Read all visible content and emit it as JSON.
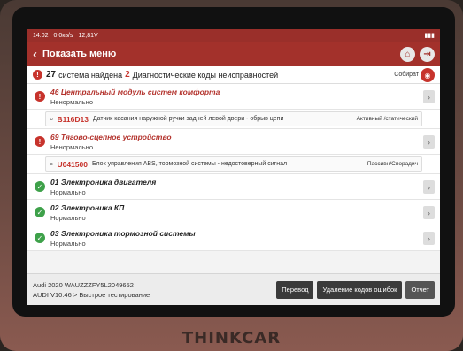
{
  "status_bar": {
    "time": "14:02",
    "speed": "0,0кв/s",
    "voltage": "12,81V"
  },
  "header": {
    "back_icon": "chevron-left-icon",
    "title": "Показать меню",
    "home_icon": "home-icon",
    "exit_icon": "exit-icon"
  },
  "summary": {
    "systems_count": "27",
    "systems_text": "система найдена",
    "dtc_count": "2",
    "dtc_text": "Диагностические коды неисправностей",
    "collect_label": "Собират"
  },
  "items": [
    {
      "name": "46 Центральный модуль систем комфорта",
      "state": "Ненормально",
      "status": "error"
    },
    {
      "name": "69 Тягово-сцепное устройство",
      "state": "Ненормально",
      "status": "error"
    },
    {
      "name": "01 Электроника двигателя",
      "state": "Нормально",
      "status": "ok"
    },
    {
      "name": "02 Электроника КП",
      "state": "Нормально",
      "status": "ok"
    },
    {
      "name": "03 Электроника тормозной системы",
      "state": "Нормально",
      "status": "ok"
    }
  ],
  "dtcs": [
    {
      "code": "B116D13",
      "description": "Датчик касания наружной ручки задней левой двери - обрыв цепи",
      "status": "Активный /статический"
    },
    {
      "code": "U041500",
      "description": "Блок управления ABS, тормозной системы - недостоверный сигнал",
      "status": "Пассивн/Спорадич"
    }
  ],
  "footer": {
    "vehicle": "Audi  2020  WAUZZZFY5L2049652",
    "software": "AUDI V10.46 > Быстрое тестирование",
    "translate_btn": "Перевод",
    "clear_btn": "Удаление кодов ошибок",
    "report_btn": "Отчет"
  },
  "brand": "THINKCAR",
  "colors": {
    "accent": "#a3312b",
    "error": "#c7332c",
    "ok": "#3ea14a"
  }
}
